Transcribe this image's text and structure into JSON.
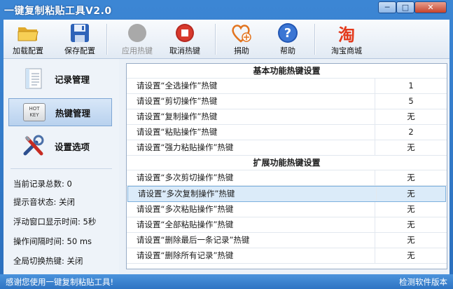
{
  "window": {
    "title": "一键复制粘贴工具V2.0"
  },
  "toolbar": {
    "load": "加载配置",
    "save": "保存配置",
    "apply": "应用热键",
    "cancel": "取消热键",
    "donate": "捐助",
    "help": "帮助",
    "taobao": "淘宝商城",
    "taobao_glyph": "淘"
  },
  "nav": {
    "records": "记录管理",
    "hotkeys": "热键管理",
    "settings": "设置选项",
    "hotkey_icon_text": "HOT\nKEY"
  },
  "info": {
    "total": "当前记录总数: 0",
    "sound": "提示音状态: 关闭",
    "float": "浮动窗口显示时间: 5秒",
    "interval": "操作间隔时间: 50 ms",
    "global": "全局切换热键: 关闭"
  },
  "basic": {
    "header": "基本功能热键设置",
    "rows": [
      {
        "label": "请设置“全选操作”热键",
        "value": "1"
      },
      {
        "label": "请设置“剪切操作”热键",
        "value": "5"
      },
      {
        "label": "请设置“复制操作”热键",
        "value": "无"
      },
      {
        "label": "请设置“粘贴操作”热键",
        "value": "2"
      },
      {
        "label": "请设置“强力粘贴操作”热键",
        "value": "无"
      }
    ]
  },
  "extended": {
    "header": "扩展功能热键设置",
    "rows": [
      {
        "label": "请设置“多次剪切操作”热键",
        "value": "无"
      },
      {
        "label": "请设置“多次复制操作”热键",
        "value": "无"
      },
      {
        "label": "请设置“多次粘贴操作”热键",
        "value": "无"
      },
      {
        "label": "请设置“全部粘贴操作”热键",
        "value": "无"
      },
      {
        "label": "请设置“删除最后一条记录”热键",
        "value": "无"
      },
      {
        "label": "请设置“删除所有记录”热键",
        "value": "无"
      }
    ]
  },
  "status": {
    "left": "感谢您使用一键复制粘贴工具!",
    "right": "检测软件版本"
  }
}
